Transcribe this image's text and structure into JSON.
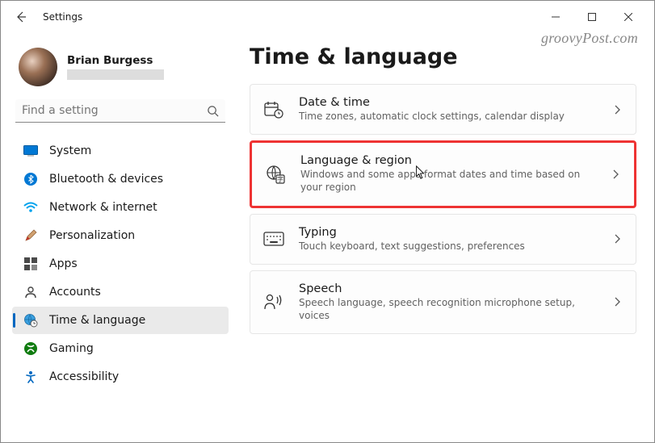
{
  "titlebar": {
    "title": "Settings"
  },
  "watermark": "groovyPost.com",
  "profile": {
    "name": "Brian Burgess"
  },
  "search": {
    "placeholder": "Find a setting"
  },
  "sidebar": {
    "items": [
      {
        "label": "System"
      },
      {
        "label": "Bluetooth & devices"
      },
      {
        "label": "Network & internet"
      },
      {
        "label": "Personalization"
      },
      {
        "label": "Apps"
      },
      {
        "label": "Accounts"
      },
      {
        "label": "Time & language"
      },
      {
        "label": "Gaming"
      },
      {
        "label": "Accessibility"
      }
    ]
  },
  "page": {
    "title": "Time & language",
    "cards": [
      {
        "title": "Date & time",
        "desc": "Time zones, automatic clock settings, calendar display"
      },
      {
        "title": "Language & region",
        "desc": "Windows and some apps format dates and time based on your region"
      },
      {
        "title": "Typing",
        "desc": "Touch keyboard, text suggestions, preferences"
      },
      {
        "title": "Speech",
        "desc": "Speech language, speech recognition microphone setup, voices"
      }
    ]
  }
}
